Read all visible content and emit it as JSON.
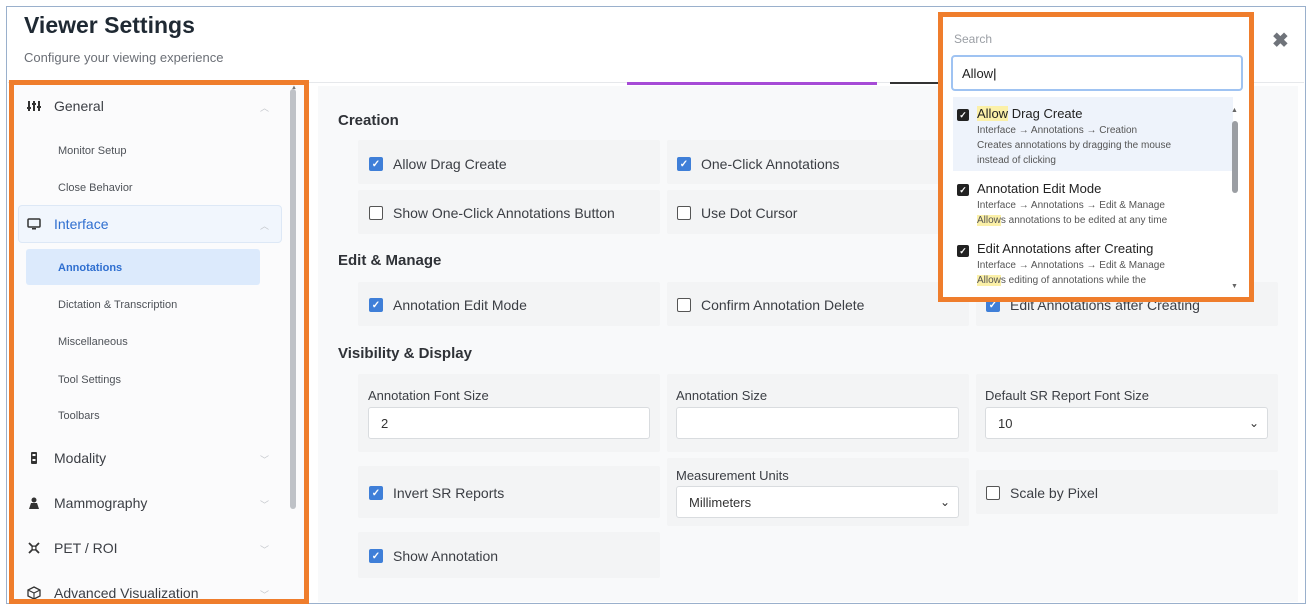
{
  "header": {
    "title": "Viewer Settings",
    "subtitle": "Configure your viewing experience",
    "close_icon": "close-icon"
  },
  "sidebar": {
    "groups": [
      {
        "label": "General",
        "icon": "sliders-icon",
        "items": [
          "Monitor Setup",
          "Close Behavior"
        ]
      },
      {
        "label": "Interface",
        "icon": "monitor-icon",
        "items": [
          "Annotations",
          "Dictation & Transcription",
          "Miscellaneous",
          "Tool Settings",
          "Toolbars"
        ]
      },
      {
        "label": "Modality",
        "icon": "device-icon"
      },
      {
        "label": "Mammography",
        "icon": "people-icon"
      },
      {
        "label": "PET / ROI",
        "icon": "roi-icon"
      },
      {
        "label": "Advanced Visualization",
        "icon": "cube-icon"
      }
    ],
    "active_item": "Annotations"
  },
  "content": {
    "creation": {
      "title": "Creation",
      "options": [
        {
          "label": "Allow Drag Create",
          "checked": true
        },
        {
          "label": "One-Click Annotations",
          "checked": true
        },
        {
          "label": "Show One-Click Annotations Button",
          "checked": false
        },
        {
          "label": "Use Dot Cursor",
          "checked": false
        }
      ]
    },
    "edit_manage": {
      "title": "Edit & Manage",
      "options": [
        {
          "label": "Annotation Edit Mode",
          "checked": true
        },
        {
          "label": "Confirm Annotation Delete",
          "checked": false
        },
        {
          "label": "Edit Annotations after Creating",
          "checked": true
        }
      ]
    },
    "visibility": {
      "title": "Visibility & Display",
      "annotation_font_size_label": "Annotation Font Size",
      "annotation_font_size_value": "2",
      "annotation_size_label": "Annotation Size",
      "annotation_size_value": "",
      "sr_font_size_label": "Default SR Report Font Size",
      "sr_font_size_value": "10",
      "invert_sr_label": "Invert SR Reports",
      "measurement_units_label": "Measurement Units",
      "measurement_units_value": "Millimeters",
      "scale_by_pixel_label": "Scale by Pixel",
      "show_annotation_label": "Show Annotation"
    }
  },
  "search": {
    "label": "Search",
    "value": "Allow",
    "results": [
      {
        "title_hl": "Allow",
        "title_rest": " Drag Create",
        "path": "Interface → Annotations → Creation",
        "desc1": "Creates annotations by dragging the mouse",
        "desc2": "instead of clicking"
      },
      {
        "title": "Annotation Edit Mode",
        "path": "Interface → Annotations → Edit & Manage",
        "desc_hl": "Allow",
        "desc_rest": "s annotations to be edited at any time"
      },
      {
        "title": "Edit Annotations after Creating",
        "path": "Interface → Annotations → Edit & Manage",
        "desc_hl": "Allow",
        "desc_rest": "s editing of annotations while the"
      }
    ]
  },
  "colors": {
    "highlight_border": "#ef7d2c",
    "accent": "#3f7fd8",
    "tab_purple": "#a64bd6"
  }
}
